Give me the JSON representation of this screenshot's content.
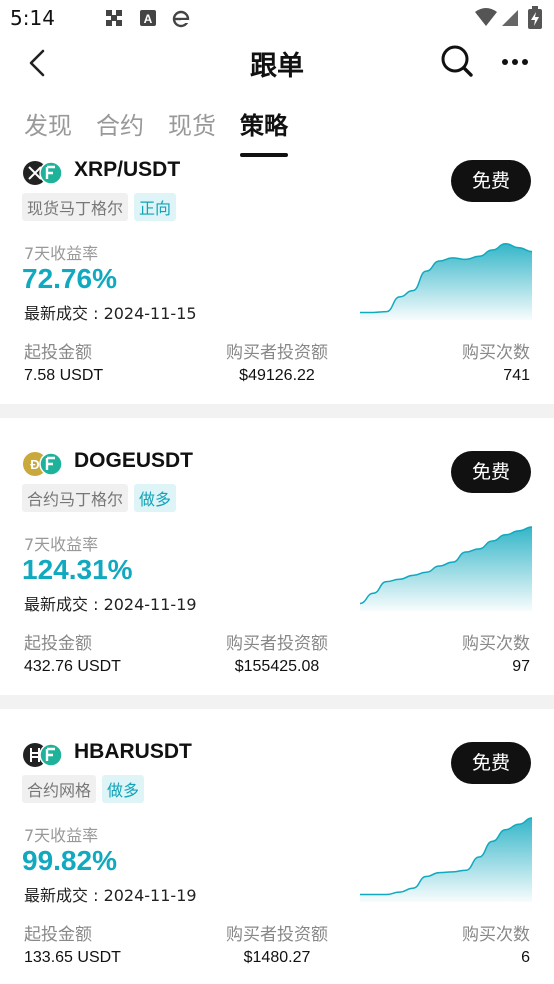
{
  "status_bar": {
    "time": "5:14",
    "left_icons": [
      "grid-icon",
      "font-icon",
      "browser-e-icon"
    ],
    "right_icons": [
      "wifi-icon",
      "signal-icon",
      "battery-charging-icon"
    ]
  },
  "header": {
    "title": "跟单",
    "back_icon": "chevron-left-icon",
    "search_icon": "search-icon",
    "more_icon": "more-dots-icon"
  },
  "tabs": [
    {
      "label": "发现",
      "active": false
    },
    {
      "label": "合约",
      "active": false
    },
    {
      "label": "现货",
      "active": false
    },
    {
      "label": "策略",
      "active": true
    }
  ],
  "colors": {
    "accent": "#11a9bf",
    "button_bg": "#111111",
    "tag_cyan_bg": "#dff4f7",
    "divider": "#f2f2f2"
  },
  "cards": [
    {
      "pair": "XRP/USDT",
      "strategy_tag": "现货马丁格尔",
      "direction_tag": "正向",
      "button_label": "免费",
      "return_label": "7天收益率",
      "return_value": "72.76%",
      "last_trade": "最新成交 : 2024-11-15",
      "stats": [
        {
          "label": "起投金额",
          "value": "7.58 USDT"
        },
        {
          "label": "购买者投资额",
          "value": "$49126.22"
        },
        {
          "label": "购买次数",
          "value": "741"
        }
      ],
      "sparkline": [
        0.02,
        0.02,
        0.03,
        0.22,
        0.3,
        0.55,
        0.68,
        0.72,
        0.7,
        0.74,
        0.82,
        0.9,
        0.85,
        0.8
      ]
    },
    {
      "pair": "DOGEUSDT",
      "strategy_tag": "合约马丁格尔",
      "direction_tag": "做多",
      "button_label": "免费",
      "return_label": "7天收益率",
      "return_value": "124.31%",
      "last_trade": "最新成交 : 2024-11-19",
      "stats": [
        {
          "label": "起投金额",
          "value": "432.76 USDT"
        },
        {
          "label": "购买者投资额",
          "value": "$155425.08"
        },
        {
          "label": "购买次数",
          "value": "97"
        }
      ],
      "sparkline": [
        0.02,
        0.15,
        0.3,
        0.33,
        0.38,
        0.42,
        0.5,
        0.55,
        0.68,
        0.72,
        0.82,
        0.9,
        0.95,
        1.0
      ]
    },
    {
      "pair": "HBARUSDT",
      "strategy_tag": "合约网格",
      "direction_tag": "做多",
      "button_label": "免费",
      "return_label": "7天收益率",
      "return_value": "99.82%",
      "last_trade": "最新成交 : 2024-11-19",
      "stats": [
        {
          "label": "起投金额",
          "value": "133.65 USDT"
        },
        {
          "label": "购买者投资额",
          "value": "$1480.27"
        },
        {
          "label": "购买次数",
          "value": "6"
        }
      ],
      "sparkline": [
        0.02,
        0.02,
        0.02,
        0.05,
        0.1,
        0.25,
        0.3,
        0.31,
        0.33,
        0.5,
        0.7,
        0.85,
        0.92,
        1.0
      ]
    }
  ]
}
